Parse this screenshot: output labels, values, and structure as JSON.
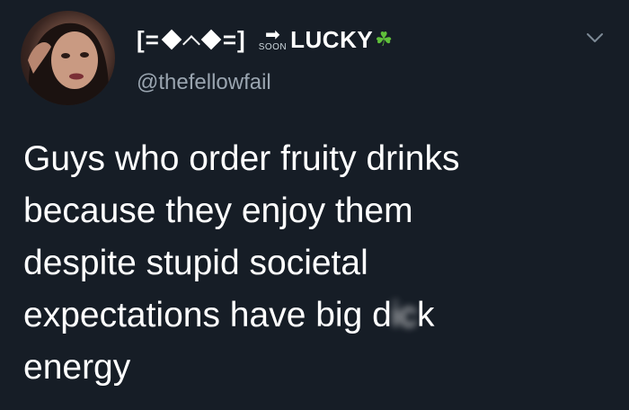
{
  "user": {
    "name_open": "[=",
    "name_close": "=]",
    "soon_arrow": "➡",
    "soon_label": "SOON",
    "lucky_label": "LUCKY",
    "clover": "☘",
    "handle": "@thefellowfail"
  },
  "tweet": {
    "lines": [
      "Guys who order fruity drinks",
      "because they enjoy them",
      "despite stupid societal",
      "expectations have big d",
      "energy"
    ],
    "censored_fragment": "ic",
    "after_censor": "k"
  },
  "icons": {
    "menu": "chevron-down-icon",
    "clover": "clover-icon"
  },
  "colors": {
    "background": "#161d26",
    "text": "#ffffff",
    "handle": "#9aa5b0",
    "clover": "#5fbf3a"
  }
}
